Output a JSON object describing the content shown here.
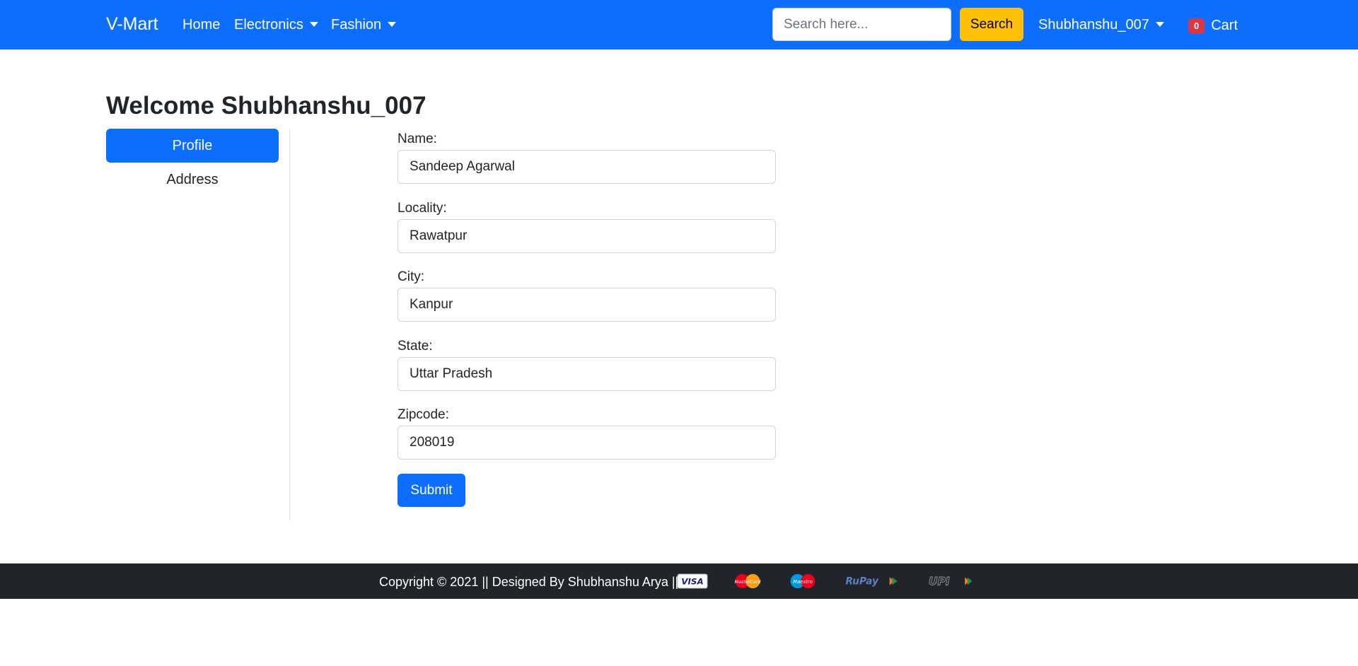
{
  "navbar": {
    "brand": "V-Mart",
    "links": [
      "Home",
      "Electronics",
      "Fashion"
    ],
    "search_placeholder": "Search here...",
    "search_button": "Search",
    "user": "Shubhanshu_007",
    "cart_count": "0",
    "cart_label": "Cart"
  },
  "page": {
    "welcome": "Welcome Shubhanshu_007"
  },
  "sidebar": {
    "items": [
      "Profile",
      "Address"
    ]
  },
  "form": {
    "fields": [
      {
        "label": "Name:",
        "value": "Sandeep Agarwal"
      },
      {
        "label": "Locality:",
        "value": "Rawatpur"
      },
      {
        "label": "City:",
        "value": "Kanpur"
      },
      {
        "label": "State:",
        "value": "Uttar Pradesh"
      },
      {
        "label": "Zipcode:",
        "value": "208019"
      }
    ],
    "submit": "Submit"
  },
  "footer": {
    "copyright": "Copyright © 2021 || Designed By Shubhanshu Arya ||",
    "payment_icons": [
      "visa-icon",
      "mastercard-icon",
      "maestro-icon",
      "rupay-icon",
      "upi-icon"
    ],
    "payment_text": [
      "VISA",
      "MasterCard",
      "Maestro",
      "RuPay",
      "UPI"
    ]
  },
  "colors": {
    "primary": "#0d6efd",
    "warning": "#ffc107",
    "danger": "#dc3545",
    "dark": "#212529"
  }
}
